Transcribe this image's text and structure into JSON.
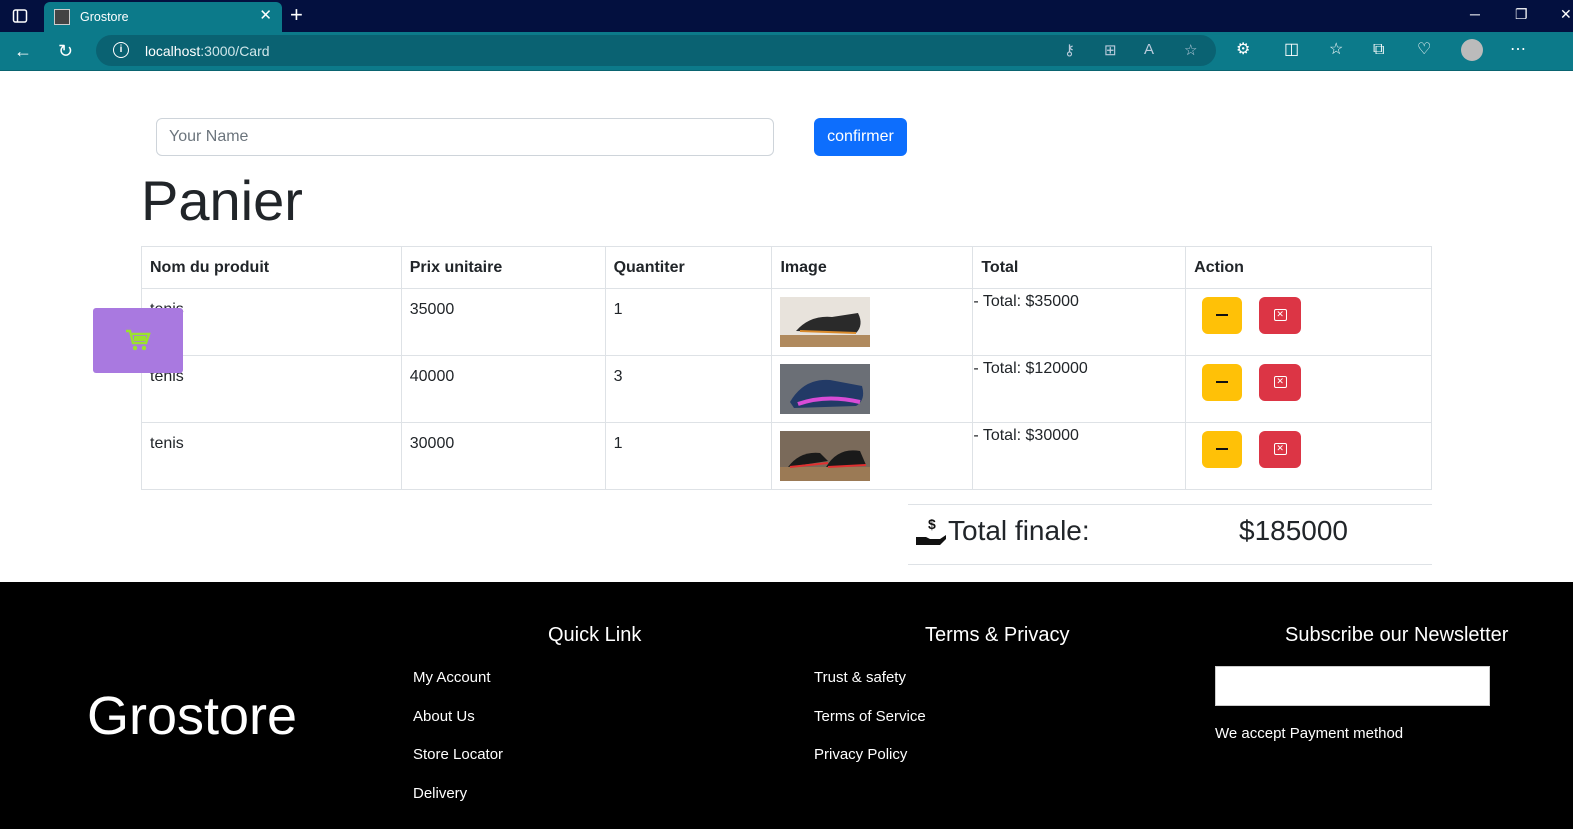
{
  "browser": {
    "tab_title": "Grostore",
    "url_host": "localhost",
    "url_rest": ":3000/Card"
  },
  "form": {
    "name_placeholder": "Your Name",
    "confirm_label": "confirmer"
  },
  "page_title": "Panier",
  "table": {
    "headers": [
      "Nom du produit",
      "Prix unitaire",
      "Quantiter",
      "Image",
      "Total",
      "Action"
    ],
    "rows": [
      {
        "name": "tenis",
        "price": "35000",
        "qty": "1",
        "total": "- Total: $35000",
        "shoe_color": "#2a2a2a",
        "accent": "#d98a2b"
      },
      {
        "name": "tenis",
        "price": "40000",
        "qty": "3",
        "total": "- Total: $120000",
        "shoe_color": "#223a66",
        "accent": "#d84bd6"
      },
      {
        "name": "tenis",
        "price": "30000",
        "qty": "1",
        "total": "- Total: $30000",
        "shoe_color": "#1a1a1a",
        "accent": "#e03030"
      }
    ]
  },
  "summary": {
    "label": "Total finale:",
    "value": "$185000"
  },
  "footer": {
    "brand": "Grostore",
    "quick_link": {
      "title": "Quick Link",
      "items": [
        "My Account",
        "About Us",
        "Store Locator",
        "Delivery"
      ]
    },
    "terms": {
      "title": "Terms & Privacy",
      "items": [
        "Trust & safety",
        "Terms of Service",
        "Privacy Policy"
      ]
    },
    "newsletter": {
      "title": "Subscribe our Newsletter",
      "accept_text": "We accept Payment method"
    }
  },
  "colors": {
    "primary": "#0d6efd",
    "warning": "#ffc107",
    "danger": "#dc3545",
    "float_cart": "#a979e0",
    "cart_icon": "#9be22d"
  }
}
